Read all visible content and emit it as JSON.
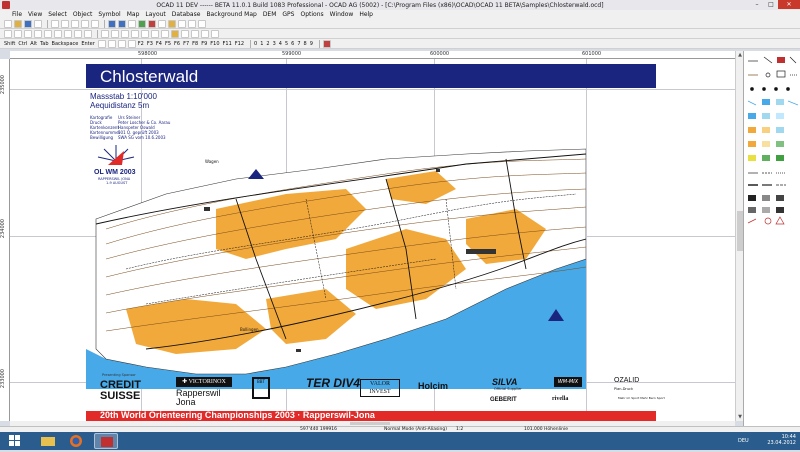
{
  "window": {
    "title": "OCAD 11 DEV ------ BETA 11.0.1 Build 1083  Professional - OCAD AG (5002) - [C:\\Program Files (x86)\\OCAD\\OCAD 11 BETA\\Samples\\Chlosterwald.ocd]",
    "min": "–",
    "max": "□",
    "close": "✕"
  },
  "menu": [
    "File",
    "View",
    "Select",
    "Object",
    "Symbol",
    "Map",
    "Layout",
    "Database",
    "Background Map",
    "DEM",
    "GPS",
    "Options",
    "Window",
    "Help"
  ],
  "toolbar3": {
    "keys": [
      "Shift",
      "Ctrl",
      "Alt",
      "Tab",
      "Backspace",
      "Enter"
    ],
    "fkeys": [
      "F2",
      "F3",
      "F4",
      "F5",
      "F6",
      "F7",
      "F8",
      "F9",
      "F10",
      "F11",
      "F12"
    ],
    "digits": [
      "0",
      "1",
      "2",
      "3",
      "4",
      "5",
      "6",
      "7",
      "8",
      "9"
    ]
  },
  "rulers": {
    "top": [
      "598000",
      "599000",
      "600000",
      "601000"
    ],
    "left": [
      "235000",
      "234000",
      "233000"
    ]
  },
  "map": {
    "title": "Chlosterwald",
    "scale": "Massstab 1:10'000",
    "contour": "Aequidistanz 5m",
    "credits": [
      {
        "k": "Kartografie",
        "v": "Urs Steiner"
      },
      {
        "k": "Druck",
        "v": "Peter Loscher & Co. Aarau"
      },
      {
        "k": "Kartenkonzent",
        "v": "Hanspeter Oswald"
      },
      {
        "k": "Kartennummer",
        "v": "501 Q. geprüft 2003"
      },
      {
        "k": "Bewilligung",
        "v": "SWA SG vom 10.6.2003"
      }
    ],
    "event_logo": "OL WM 2003",
    "event_sub1": "RAPPERSWIL JONA",
    "event_sub2": "1-9 AUGUST",
    "place_labels": [
      "Wagen",
      "Bollingen"
    ],
    "bottom_banner": "20th World Orienteering Championships 2003 · Rapperswil-Jona"
  },
  "sponsors": {
    "presenting": "Presenting Sponsor",
    "credit_suisse_1": "CREDIT",
    "credit_suisse_2": "SUISSE",
    "victorinox": "✚ VICTORINOX",
    "rapperswil_1": "Rapperswil",
    "rapperswil_2": "Jona",
    "bbt": "BBT",
    "terdiv": "TER DIV4",
    "valor_1": "VALOR",
    "valor_2": "INVEST",
    "holcim": "Holcim",
    "silva": "SILVA",
    "silva_sub": "Official Supplier",
    "geberit": "GEBERIT",
    "wmx": "WM-MIX",
    "rivella": "rivella",
    "ozalid": "OZALID",
    "ozalid_sub": "Plan-Druck",
    "bern": "Mehr im Sport Mehr Bern Sport"
  },
  "status": {
    "coords": "597'440   199916",
    "mode": "Normal Mode (Anti-Aliasing)",
    "zoom": "1:2",
    "symbol": "101.000 Höhenlinie"
  },
  "tray": {
    "lang": "DEU",
    "time": "10:44",
    "date": "23.04.2012"
  },
  "colors": {
    "banner_blue": "#1a2580",
    "banner_red": "#e22a28",
    "open_land": "#f2a93b",
    "water": "#47a9e8",
    "forest": "#ffffff"
  }
}
